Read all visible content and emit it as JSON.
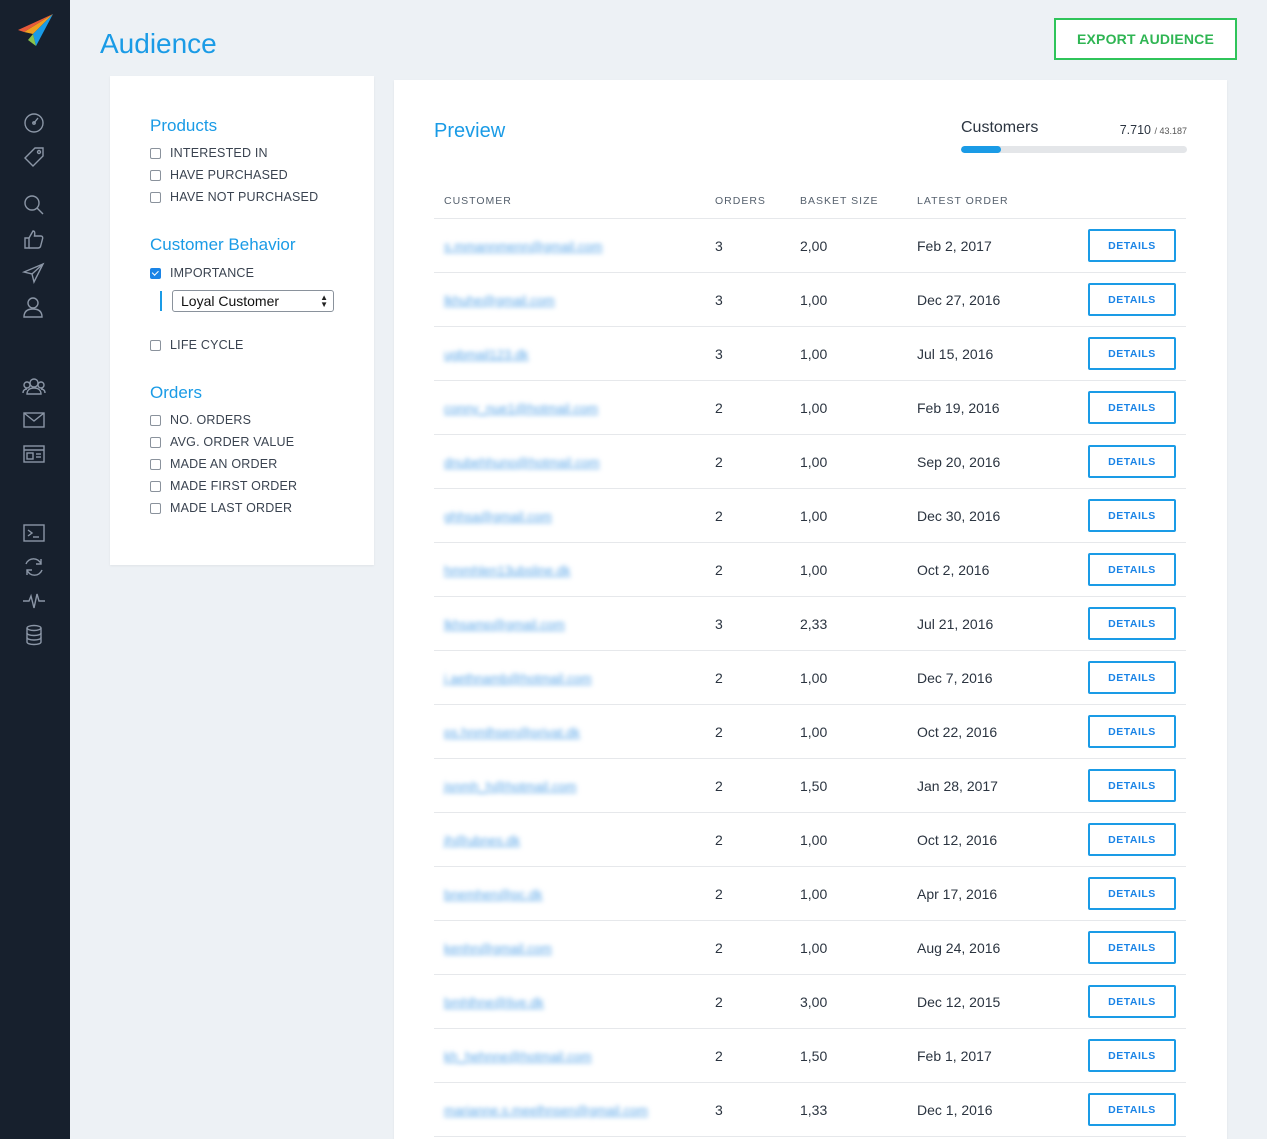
{
  "page": {
    "title": "Audience",
    "export_label": "EXPORT AUDIENCE"
  },
  "colors": {
    "accent": "#1a9be6",
    "export_green": "#2fc45a",
    "sidebar": "#17202d"
  },
  "sidebar": {
    "icons": [
      "dashboard-icon",
      "tag-icon",
      "search-icon",
      "thumbs-up-icon",
      "send-icon",
      "user-icon",
      "users-icon",
      "mail-icon",
      "browser-window-icon",
      "terminal-icon",
      "refresh-icon",
      "activity-icon",
      "database-icon"
    ]
  },
  "filters": {
    "products": {
      "title": "Products",
      "options": [
        {
          "label": "INTERESTED IN",
          "checked": false
        },
        {
          "label": "HAVE PURCHASED",
          "checked": false
        },
        {
          "label": "HAVE NOT PURCHASED",
          "checked": false
        }
      ]
    },
    "behavior": {
      "title": "Customer Behavior",
      "importance": {
        "label": "IMPORTANCE",
        "checked": true
      },
      "importance_select": "Loyal Customer",
      "lifecycle": {
        "label": "LIFE CYCLE",
        "checked": false
      }
    },
    "orders": {
      "title": "Orders",
      "options": [
        {
          "label": "NO. ORDERS",
          "checked": false
        },
        {
          "label": "AVG. ORDER VALUE",
          "checked": false
        },
        {
          "label": "MADE AN ORDER",
          "checked": false
        },
        {
          "label": "MADE FIRST ORDER",
          "checked": false
        },
        {
          "label": "MADE LAST ORDER",
          "checked": false
        }
      ]
    }
  },
  "preview": {
    "title": "Preview",
    "customers_label": "Customers",
    "count": "7.710",
    "total": "/ 43.187",
    "progress_fraction": 0.1785
  },
  "table": {
    "headers": [
      "CUSTOMER",
      "ORDERS",
      "BASKET SIZE",
      "LATEST ORDER"
    ],
    "details_label": "DETAILS",
    "rows": [
      {
        "email": "s.mmannmenn@gmail.com",
        "orders": "3",
        "basket": "2,00",
        "latest": "Feb 2, 2017"
      },
      {
        "email": "lkhuhe@gmail.com",
        "orders": "3",
        "basket": "1,00",
        "latest": "Dec 27, 2016"
      },
      {
        "email": "ugbmail123.dk",
        "orders": "3",
        "basket": "1,00",
        "latest": "Jul 15, 2016"
      },
      {
        "email": "conny_nue1@hotmail.com",
        "orders": "2",
        "basket": "1,00",
        "latest": "Feb 19, 2016"
      },
      {
        "email": "dnubehhuno@hotmail.com",
        "orders": "2",
        "basket": "1,00",
        "latest": "Sep 20, 2016"
      },
      {
        "email": "ghhsa@gmail.com",
        "orders": "2",
        "basket": "1,00",
        "latest": "Dec 30, 2016"
      },
      {
        "email": "hmmhlen13ubsline.dk",
        "orders": "2",
        "basket": "1,00",
        "latest": "Oct 2, 2016"
      },
      {
        "email": "lkhsamp@gmail.com",
        "orders": "3",
        "basket": "2,33",
        "latest": "Jul 21, 2016"
      },
      {
        "email": "j.aethnamb@hotmail.com",
        "orders": "2",
        "basket": "1,00",
        "latest": "Dec 7, 2016"
      },
      {
        "email": "ps.hnmlhsen@privat.dk",
        "orders": "2",
        "basket": "1,00",
        "latest": "Oct 22, 2016"
      },
      {
        "email": "jsnmh_h@hotmail.com",
        "orders": "2",
        "basket": "1,50",
        "latest": "Jan 28, 2017"
      },
      {
        "email": "jh@ubnes.dk",
        "orders": "2",
        "basket": "1,00",
        "latest": "Oct 12, 2016"
      },
      {
        "email": "bnemhen@pc.dk",
        "orders": "2",
        "basket": "1,00",
        "latest": "Apr 17, 2016"
      },
      {
        "email": "kenhn@gmail.com",
        "orders": "2",
        "basket": "1,00",
        "latest": "Aug 24, 2016"
      },
      {
        "email": "bmhlhne@live.dk",
        "orders": "2",
        "basket": "3,00",
        "latest": "Dec 12, 2015"
      },
      {
        "email": "kh_hehnne@hotmail.com",
        "orders": "2",
        "basket": "1,50",
        "latest": "Feb 1, 2017"
      },
      {
        "email": "marianne.s.meelhnsen@gmail.com",
        "orders": "3",
        "basket": "1,33",
        "latest": "Dec 1, 2016"
      }
    ]
  }
}
